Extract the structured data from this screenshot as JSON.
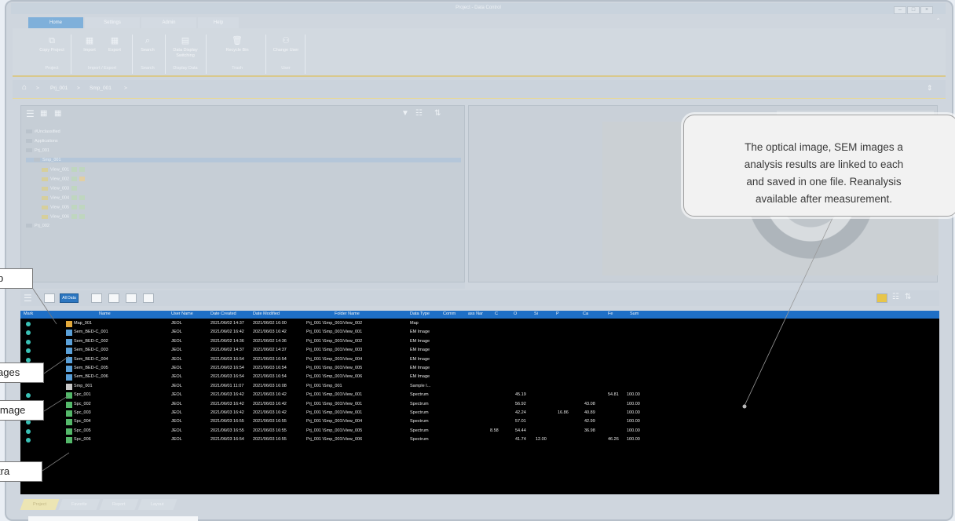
{
  "window": {
    "title": "Project - Data Control"
  },
  "tabs": [
    {
      "label": "Home"
    },
    {
      "label": "Settings"
    },
    {
      "label": "Admin"
    },
    {
      "label": "Help"
    }
  ],
  "ribbon": {
    "project": {
      "label": "Project",
      "copy": "Copy Project"
    },
    "io": {
      "label": "Import / Export",
      "import": "Import",
      "export": "Export"
    },
    "search": {
      "label": "Search",
      "search": "Search"
    },
    "display": {
      "label": "Display Data",
      "switching": "Data Display Switching"
    },
    "trash": {
      "label": "Trash",
      "recycle": "Recycle Bin"
    },
    "user": {
      "label": "User",
      "change": "Change User"
    }
  },
  "breadcrumb": {
    "level1": "Prj_001",
    "level2": "Smp_001"
  },
  "tree": [
    {
      "label": "#Unclassified"
    },
    {
      "label": "Applications"
    },
    {
      "label": "Prj_001"
    },
    {
      "label": "Smp_001"
    },
    {
      "label": "View_001"
    },
    {
      "label": "View_002"
    },
    {
      "label": "View_003"
    },
    {
      "label": "View_004"
    },
    {
      "label": "View_005"
    },
    {
      "label": "View_006"
    },
    {
      "label": "Prj_002"
    }
  ],
  "toolbar": {
    "all_data": "All Data"
  },
  "grid": {
    "headers": [
      "Mark",
      "Name",
      "User Name",
      "Date Created",
      "Date Modified",
      "Folder Name",
      "Data Type",
      "Comm",
      "ass Nar",
      "C",
      "O",
      "Si",
      "P",
      "Ca",
      "Fe",
      "Sum"
    ],
    "rows": [
      {
        "icon": "map",
        "name": "Map_001",
        "user": "JEOL",
        "created": "2021/06/02 14:37",
        "modified": "2021/06/02 16:00",
        "folder": "Prj_001 \\Smp_001\\View_002",
        "type": "Map",
        "C": "",
        "O": "",
        "Si": "",
        "P": "",
        "Ca": "",
        "Fe": "",
        "Sum": ""
      },
      {
        "icon": "sem",
        "name": "Sem_BED-C_001",
        "user": "JEOL",
        "created": "2021/06/02 16:42",
        "modified": "2021/06/03 16:42",
        "folder": "Prj_001 \\Smp_001\\View_001",
        "type": "EM Image",
        "C": "",
        "O": "",
        "Si": "",
        "P": "",
        "Ca": "",
        "Fe": "",
        "Sum": ""
      },
      {
        "icon": "sem",
        "name": "Sem_BED-C_002",
        "user": "JEOL",
        "created": "2021/06/02 14:36",
        "modified": "2021/06/02 14:36",
        "folder": "Prj_001 \\Smp_001\\View_002",
        "type": "EM Image",
        "C": "",
        "O": "",
        "Si": "",
        "P": "",
        "Ca": "",
        "Fe": "",
        "Sum": ""
      },
      {
        "icon": "sem",
        "name": "Sem_BED-C_003",
        "user": "JEOL",
        "created": "2021/06/02 14:37",
        "modified": "2021/06/02 14:37",
        "folder": "Prj_001 \\Smp_001\\View_003",
        "type": "EM Image",
        "C": "",
        "O": "",
        "Si": "",
        "P": "",
        "Ca": "",
        "Fe": "",
        "Sum": ""
      },
      {
        "icon": "sem",
        "name": "Sem_BED-C_004",
        "user": "JEOL",
        "created": "2021/06/03 16:54",
        "modified": "2021/06/03 16:54",
        "folder": "Prj_001 \\Smp_001\\View_004",
        "type": "EM Image",
        "C": "",
        "O": "",
        "Si": "",
        "P": "",
        "Ca": "",
        "Fe": "",
        "Sum": ""
      },
      {
        "icon": "sem",
        "name": "Sem_BED-C_005",
        "user": "JEOL",
        "created": "2021/06/03 16:54",
        "modified": "2021/06/03 16:54",
        "folder": "Prj_001 \\Smp_001\\View_005",
        "type": "EM Image",
        "C": "",
        "O": "",
        "Si": "",
        "P": "",
        "Ca": "",
        "Fe": "",
        "Sum": ""
      },
      {
        "icon": "sem",
        "name": "Sem_BED-C_006",
        "user": "JEOL",
        "created": "2021/06/03 16:54",
        "modified": "2021/06/03 16:54",
        "folder": "Prj_001 \\Smp_001\\View_006",
        "type": "EM Image",
        "C": "",
        "O": "",
        "Si": "",
        "P": "",
        "Ca": "",
        "Fe": "",
        "Sum": ""
      },
      {
        "icon": "sample",
        "name": "Smp_001",
        "user": "JEOL",
        "created": "2021/06/01 11:07",
        "modified": "2021/06/03 16:08",
        "folder": "Prj_001 \\Smp_001",
        "type": "Sample I...",
        "C": "",
        "O": "",
        "Si": "",
        "P": "",
        "Ca": "",
        "Fe": "",
        "Sum": ""
      },
      {
        "icon": "spc",
        "name": "Spc_001",
        "user": "JEOL",
        "created": "2021/06/03 16:42",
        "modified": "2021/06/03 16:42",
        "folder": "Prj_001 \\Smp_001\\View_001",
        "type": "Spectrum",
        "C": "",
        "O": "45.19",
        "Si": "",
        "P": "",
        "Ca": "",
        "Fe": "54.81",
        "Sum": "100.00"
      },
      {
        "icon": "spc",
        "name": "Spc_002",
        "user": "JEOL",
        "created": "2021/06/03 16:42",
        "modified": "2021/06/03 16:42",
        "folder": "Prj_001 \\Smp_001\\View_001",
        "type": "Spectrum",
        "C": "",
        "O": "56.92",
        "Si": "",
        "P": "",
        "Ca": "43.08",
        "Fe": "",
        "Sum": "100.00"
      },
      {
        "icon": "spc",
        "name": "Spc_003",
        "user": "JEOL",
        "created": "2021/06/03 16:42",
        "modified": "2021/06/03 16:42",
        "folder": "Prj_001 \\Smp_001\\View_001",
        "type": "Spectrum",
        "C": "",
        "O": "42.24",
        "Si": "",
        "P": "16.86",
        "Ca": "40.89",
        "Fe": "",
        "Sum": "100.00"
      },
      {
        "icon": "spc",
        "name": "Spc_004",
        "user": "JEOL",
        "created": "2021/06/03 16:55",
        "modified": "2021/06/03 16:55",
        "folder": "Prj_001 \\Smp_001\\View_004",
        "type": "Spectrum",
        "C": "",
        "O": "57.01",
        "Si": "",
        "P": "",
        "Ca": "42.99",
        "Fe": "",
        "Sum": "100.00"
      },
      {
        "icon": "spc",
        "name": "Spc_005",
        "user": "JEOL",
        "created": "2021/06/03 16:55",
        "modified": "2021/06/03 16:55",
        "folder": "Prj_001 \\Smp_001\\View_005",
        "type": "Spectrum",
        "C": "8.58",
        "O": "54.44",
        "Si": "",
        "P": "",
        "Ca": "36.98",
        "Fe": "",
        "Sum": "100.00"
      },
      {
        "icon": "spc",
        "name": "Spc_006",
        "user": "JEOL",
        "created": "2021/06/03 16:54",
        "modified": "2021/06/03 16:55",
        "folder": "Prj_001 \\Smp_001\\View_006",
        "type": "Spectrum",
        "C": "",
        "O": "41.74",
        "Si": "12.00",
        "P": "",
        "Ca": "",
        "Fe": "46.26",
        "Sum": "100.00"
      }
    ]
  },
  "bottom_tabs": [
    {
      "label": "Project"
    },
    {
      "label": "Favorite"
    },
    {
      "label": "Report"
    },
    {
      "label": "Layout"
    }
  ],
  "callout": {
    "line1": "The optical image, SEM images a",
    "line2": "analysis results are linked to each",
    "line3": "and saved in one file. Reanalysis",
    "line4": "available after measurement."
  },
  "labels": {
    "map": "p",
    "images": "ages",
    "image": "image",
    "spectra": "tra"
  },
  "colors": {
    "accent": "#1e6fc6",
    "grid_bg": "#000000",
    "mark": "#3ac1b6"
  }
}
